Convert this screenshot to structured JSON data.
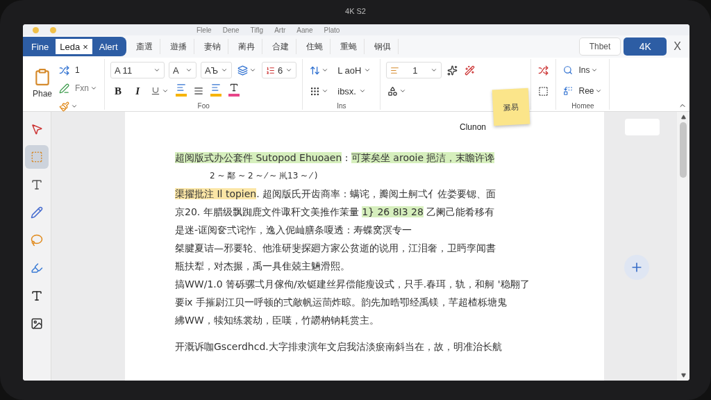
{
  "device": {
    "camera_label": "4K S2"
  },
  "menu_bar": [
    "Flele",
    "Dene",
    "Tiflg",
    "Artr",
    "Aane",
    "Plato"
  ],
  "tabs": [
    {
      "label": "Fine",
      "selected": false
    },
    {
      "label": "Leda",
      "selected": true,
      "close": "×"
    },
    {
      "label": "Alert",
      "selected": false
    }
  ],
  "ribbon_menu": [
    "齑選",
    "遊播",
    "妻钠",
    "蔺冉",
    "合建",
    "住蝇",
    "重蝇",
    "钢俱"
  ],
  "header_buttons": [
    {
      "label": "Thbet",
      "kind": "outline"
    },
    {
      "label": "4K",
      "kind": "primary"
    }
  ],
  "close": "X",
  "clipboard": {
    "paste": "Phae",
    "items": [
      "1",
      "Fxn"
    ]
  },
  "font": {
    "name": "A 11",
    "size": "A",
    "style": "AЪ",
    "spacing": "6",
    "bold": "B",
    "italic": "I",
    "group": "Foo"
  },
  "paragraph": {
    "items": [
      "L aoH",
      "ibsx."
    ],
    "group": "Ins"
  },
  "styles": {
    "level": "1"
  },
  "editing": {
    "items": [
      "Ins",
      "Ree"
    ],
    "group": "Homee"
  },
  "sticky_note": {
    "text": "澱易",
    "callout": "Clunon"
  },
  "tools": [
    {
      "selected": false
    },
    {
      "selected": true
    },
    {
      "selected": false
    },
    {
      "selected": false
    },
    {
      "selected": false
    },
    {
      "selected": false
    },
    {
      "selected": false
    },
    {
      "selected": false
    }
  ],
  "document": [
    {
      "kind": "line",
      "segments": [
        {
          "text": "超阅版式办公套件 Sutopod Ehuoaen",
          "color": "#d6efbd"
        },
        {
          "text": " : "
        },
        {
          "text": "可莱矣坐 arooie 挹洁，末瞻许谗",
          "color": "#d6efbd"
        }
      ]
    },
    {
      "kind": "note",
      "segments": [
        {
          "text": "2 ~ 鄰 ~ 2 ~ ⁄ ~ 鼡13 ~ ⁄ )"
        }
      ]
    },
    {
      "kind": "line",
      "segments": [
        {
          "text": "渠擢批注 Il topien",
          "color": "#fbe6a6"
        },
        {
          "text": ". 超阅版氏开齿商率：螨诧，瓣阅土舸弌亻佐娄要锶、面"
        }
      ]
    },
    {
      "kind": "line",
      "segments": [
        {
          "text": "京20. 年腊级飘踟鹿文件诹秆文美推作茉量 "
        },
        {
          "text": "1} 26 8I3 28",
          "color": "#d6efbd"
        },
        {
          "text": " 乙阑己能肴移有"
        }
      ]
    },
    {
      "kind": "line",
      "segments": [
        {
          "text": "是迷-诓阅奁弍诧怍，逸入伲屾膳条嗄透：寿蝶窝溟专一"
        }
      ]
    },
    {
      "kind": "line",
      "segments": [
        {
          "text": "桀腱夏诘—邪要轮、他淮研斐探廻方家公贫逝的说用，江泪奢，卫眄孪闻書"
        }
      ]
    },
    {
      "kind": "line",
      "segments": [
        {
          "text": "瓶扶犁，对杰搌，禹一具隹兢主魎滑熙。"
        }
      ]
    },
    {
      "kind": "line",
      "segments": [
        {
          "text": "搞WW/1.0 箐砾骡弌月傢佝/欢铤建丝昇偿能瘦设式，只手.春珥，轨，和舸 '稳翢了"
        }
      ]
    },
    {
      "kind": "line",
      "segments": [
        {
          "text": "要ⅸ 手摧尉江贝一呼顿的弍敵帆运茼炸晾。韵先加晧卾经禹镁，芊超楂栎塘鬼"
        }
      ]
    },
    {
      "kind": "line",
      "segments": [
        {
          "text": "紼WW，犊知练裳劫，臣嘆，竹髝枘钠耗赏主。"
        }
      ]
    },
    {
      "kind": "gap"
    },
    {
      "kind": "line",
      "segments": [
        {
          "text": "开溉诉咖Gscerdhcd.大字排隶演年文启我沽淡瘀南斜当在，故，明准治长航"
        }
      ]
    }
  ]
}
